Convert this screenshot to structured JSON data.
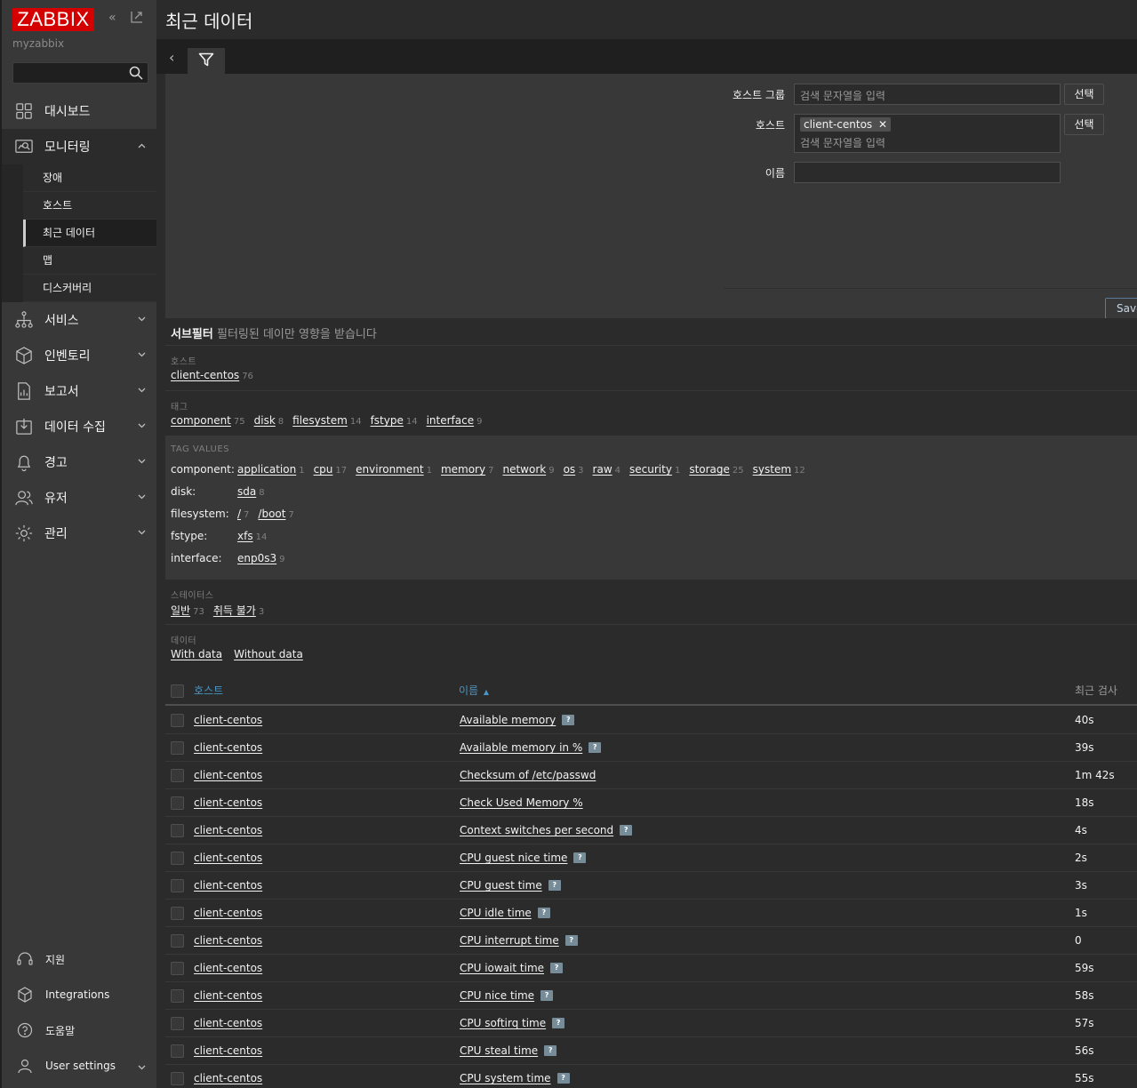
{
  "sidebar": {
    "logo": "ZABBIX",
    "server_name": "myzabbix",
    "search_placeholder": "",
    "menu": [
      {
        "label": "대시보드",
        "icon": "dashboard-icon"
      },
      {
        "label": "모니터링",
        "icon": "monitoring-icon"
      },
      {
        "label": "서비스",
        "icon": "services-icon"
      },
      {
        "label": "인벤토리",
        "icon": "inventory-icon"
      },
      {
        "label": "보고서",
        "icon": "reports-icon"
      },
      {
        "label": "데이터 수집",
        "icon": "data-collection-icon"
      },
      {
        "label": "경고",
        "icon": "alerts-icon"
      },
      {
        "label": "유저",
        "icon": "users-icon"
      },
      {
        "label": "관리",
        "icon": "administration-icon"
      }
    ],
    "submenu": [
      "장애",
      "호스트",
      "최근 데이터",
      "맵",
      "디스커버리"
    ],
    "bottom": [
      "지원",
      "Integrations",
      "도움말",
      "User settings"
    ]
  },
  "page": {
    "title": "최근 데이터"
  },
  "filter": {
    "host_group_label": "호스트 그룹",
    "host_label": "호스트",
    "name_label": "이름",
    "placeholder": "검색 문자열을 입력",
    "select_label": "선택",
    "host_chip": "client-centos",
    "name_value": "",
    "save_label": "Save"
  },
  "subfilter": {
    "title": "서브필터",
    "hint": "필터링된 데이만 영향을 받습니다",
    "host_caption": "호스트",
    "hosts": [
      {
        "name": "client-centos",
        "count": "76"
      }
    ],
    "tag_caption": "태그",
    "tags": [
      {
        "name": "component",
        "count": "75"
      },
      {
        "name": "disk",
        "count": "8"
      },
      {
        "name": "filesystem",
        "count": "14"
      },
      {
        "name": "fstype",
        "count": "14"
      },
      {
        "name": "interface",
        "count": "9"
      }
    ],
    "tag_values_caption": "TAG VALUES",
    "tag_values": [
      {
        "key": "component:",
        "values": [
          {
            "name": "application",
            "count": "1"
          },
          {
            "name": "cpu",
            "count": "17"
          },
          {
            "name": "environment",
            "count": "1"
          },
          {
            "name": "memory",
            "count": "7"
          },
          {
            "name": "network",
            "count": "9"
          },
          {
            "name": "os",
            "count": "3"
          },
          {
            "name": "raw",
            "count": "4"
          },
          {
            "name": "security",
            "count": "1"
          },
          {
            "name": "storage",
            "count": "25"
          },
          {
            "name": "system",
            "count": "12"
          }
        ]
      },
      {
        "key": "disk:",
        "values": [
          {
            "name": "sda",
            "count": "8"
          }
        ]
      },
      {
        "key": "filesystem:",
        "values": [
          {
            "name": "/",
            "count": "7"
          },
          {
            "name": "/boot",
            "count": "7"
          }
        ]
      },
      {
        "key": "fstype:",
        "values": [
          {
            "name": "xfs",
            "count": "14"
          }
        ]
      },
      {
        "key": "interface:",
        "values": [
          {
            "name": "enp0s3",
            "count": "9"
          }
        ]
      }
    ],
    "status_caption": "스테이터스",
    "statuses": [
      {
        "name": "일반",
        "count": "73"
      },
      {
        "name": "취득 불가",
        "count": "3"
      }
    ],
    "data_caption": "데이터",
    "data_opts": [
      {
        "name": "With data",
        "count": ""
      },
      {
        "name": "Without data",
        "count": ""
      }
    ]
  },
  "table": {
    "headers": {
      "host": "호스트",
      "name": "이름",
      "sort_arrow": "▲",
      "last_check": "최근 검사"
    },
    "rows": [
      {
        "host": "client-centos",
        "name": "Available memory",
        "hint": true,
        "last": "40s"
      },
      {
        "host": "client-centos",
        "name": "Available memory in %",
        "hint": true,
        "last": "39s"
      },
      {
        "host": "client-centos",
        "name": "Checksum of /etc/passwd",
        "hint": false,
        "last": "1m 42s"
      },
      {
        "host": "client-centos",
        "name": "Check Used Memory %",
        "hint": false,
        "last": "18s"
      },
      {
        "host": "client-centos",
        "name": "Context switches per second",
        "hint": true,
        "last": "4s"
      },
      {
        "host": "client-centos",
        "name": "CPU guest nice time",
        "hint": true,
        "last": "2s"
      },
      {
        "host": "client-centos",
        "name": "CPU guest time",
        "hint": true,
        "last": "3s"
      },
      {
        "host": "client-centos",
        "name": "CPU idle time",
        "hint": true,
        "last": "1s"
      },
      {
        "host": "client-centos",
        "name": "CPU interrupt time",
        "hint": true,
        "last": "0"
      },
      {
        "host": "client-centos",
        "name": "CPU iowait time",
        "hint": true,
        "last": "59s"
      },
      {
        "host": "client-centos",
        "name": "CPU nice time",
        "hint": true,
        "last": "58s"
      },
      {
        "host": "client-centos",
        "name": "CPU softirq time",
        "hint": true,
        "last": "57s"
      },
      {
        "host": "client-centos",
        "name": "CPU steal time",
        "hint": true,
        "last": "56s"
      },
      {
        "host": "client-centos",
        "name": "CPU system time",
        "hint": true,
        "last": "55s"
      }
    ],
    "hint_glyph": "?"
  }
}
